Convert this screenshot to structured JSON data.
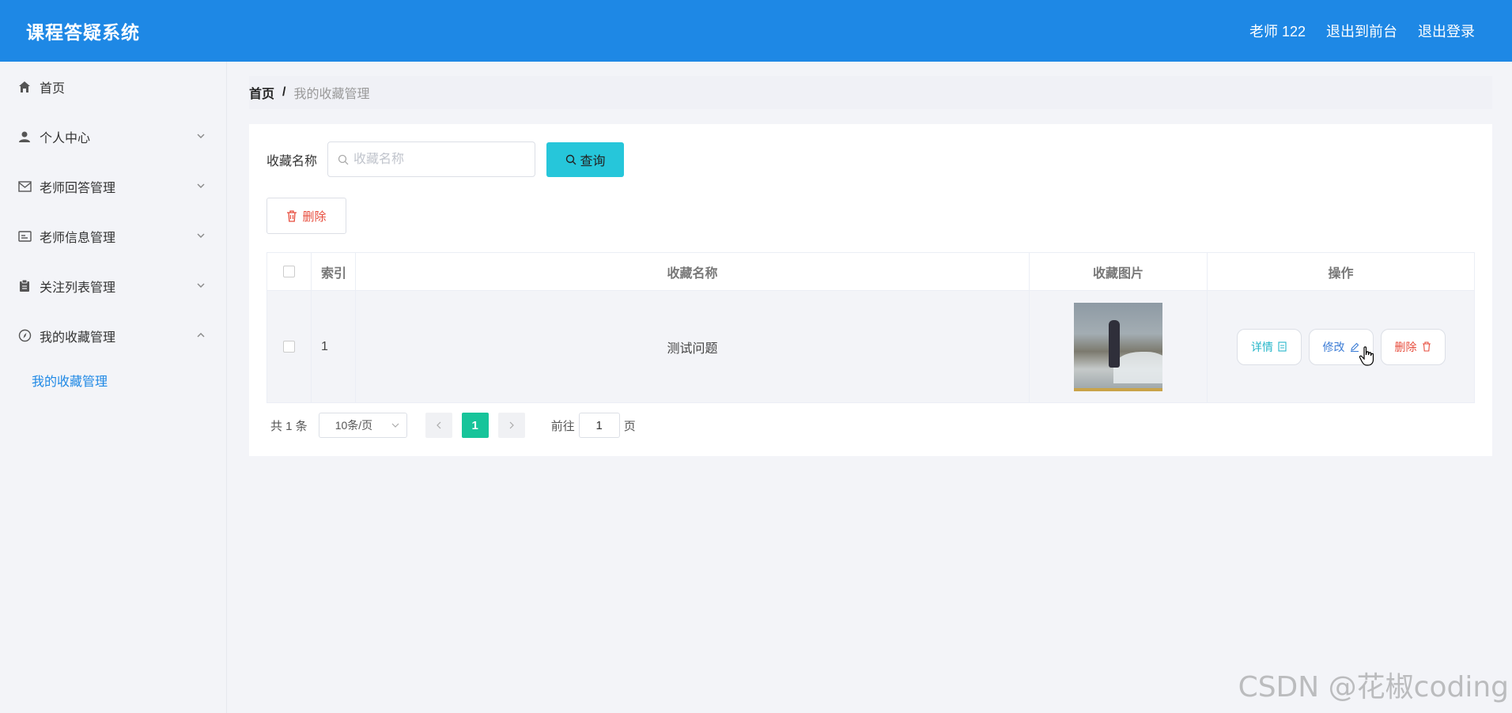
{
  "header": {
    "app_title": "课程答疑系统",
    "user_label": "老师 122",
    "front_label": "退出到前台",
    "logout_label": "退出登录"
  },
  "sidebar": {
    "items": [
      {
        "label": "首页",
        "icon": "home-icon"
      },
      {
        "label": "个人中心",
        "icon": "user-icon"
      },
      {
        "label": "老师回答管理",
        "icon": "mail-icon"
      },
      {
        "label": "老师信息管理",
        "icon": "id-card-icon"
      },
      {
        "label": "关注列表管理",
        "icon": "clipboard-icon"
      },
      {
        "label": "我的收藏管理",
        "icon": "compass-icon"
      }
    ],
    "submenu": {
      "label": "我的收藏管理"
    }
  },
  "breadcrumb": {
    "home": "首页",
    "separator": "/",
    "current": "我的收藏管理"
  },
  "search": {
    "label": "收藏名称",
    "placeholder": "收藏名称",
    "value": "",
    "button_label": "查询"
  },
  "toolbar": {
    "delete_label": "删除"
  },
  "table": {
    "columns": [
      "索引",
      "收藏名称",
      "收藏图片",
      "操作"
    ],
    "rows": [
      {
        "index": "1",
        "name": "测试问题",
        "image": "beach-photo"
      }
    ],
    "actions": {
      "detail": "详情",
      "edit": "修改",
      "delete": "删除"
    }
  },
  "pagination": {
    "total": "共 1 条",
    "page_size": "10条/页",
    "current_page": "1",
    "goto_label": "前往",
    "goto_value": "1",
    "page_unit": "页"
  },
  "watermark": "CSDN @花椒coding",
  "colors": {
    "header": "#1e88e5",
    "query_button": "#26c6da",
    "active_page": "#17c49a",
    "danger": "#e74c3c"
  }
}
